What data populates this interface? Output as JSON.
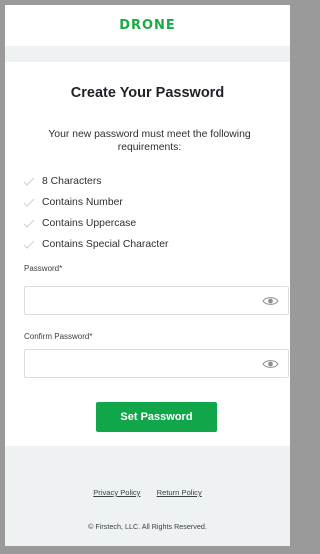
{
  "brand": {
    "name": "DRONE",
    "color": "#1aab45"
  },
  "form": {
    "title": "Create Your Password",
    "subtitle": "Your new password must meet the following requirements:",
    "requirements": [
      "8 Characters",
      "Contains Number",
      "Contains Uppercase",
      "Contains Special Character"
    ],
    "password_label": "Password*",
    "password_value": "",
    "confirm_label": "Confirm Password*",
    "confirm_value": "",
    "submit_label": "Set Password",
    "submit_color": "#12a64a"
  },
  "footer": {
    "privacy_link": "Privacy Policy",
    "return_link": "Return Policy",
    "copyright": "© Firstech, LLC. All Rights Reserved."
  },
  "icons": {
    "requirement": "check-icon",
    "show_password": "eye-icon"
  }
}
